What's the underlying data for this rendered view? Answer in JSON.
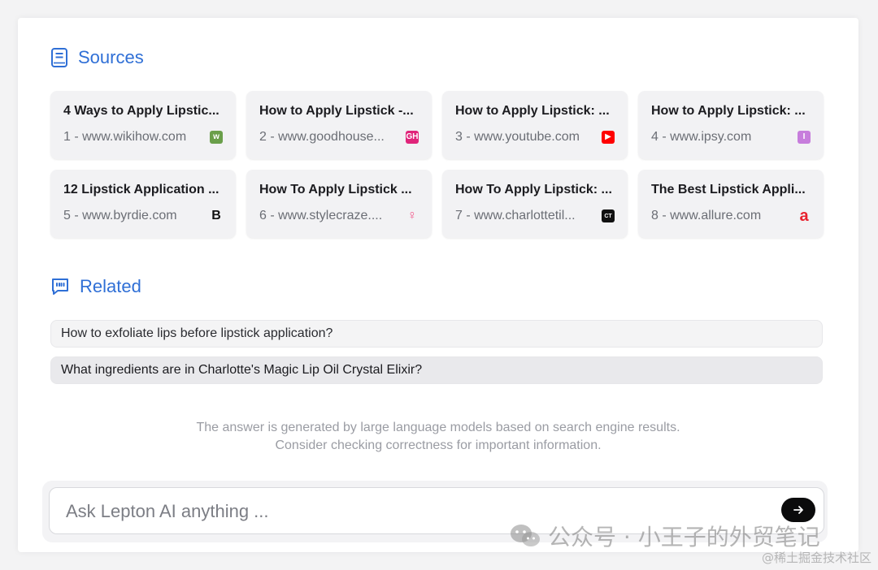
{
  "sources": {
    "heading": "Sources",
    "items": [
      {
        "title": "4 Ways to Apply Lipstic...",
        "meta": "1 - www.wikihow.com",
        "favicon": "wikihow-icon",
        "color": "#6a9f4a",
        "glyph": "w"
      },
      {
        "title": "How to Apply Lipstick -...",
        "meta": "2 - www.goodhouse...",
        "favicon": "goodhousekeeping-icon",
        "color": "#e0247a",
        "glyph": "GH"
      },
      {
        "title": "How to Apply Lipstick: ...",
        "meta": "3 - www.youtube.com",
        "favicon": "youtube-icon",
        "color": "#ff0000",
        "glyph": "▶"
      },
      {
        "title": "How to Apply Lipstick: ...",
        "meta": "4 - www.ipsy.com",
        "favicon": "ipsy-icon",
        "color": "#c77ddc",
        "glyph": "I"
      },
      {
        "title": "12 Lipstick Application ...",
        "meta": "5 - www.byrdie.com",
        "favicon": "byrdie-icon",
        "color": "#111111",
        "glyph": "B"
      },
      {
        "title": "How To Apply Lipstick ...",
        "meta": "6 - www.stylecraze....",
        "favicon": "stylecraze-icon",
        "color": "#f2588a",
        "glyph": "♀"
      },
      {
        "title": "How To Apply Lipstick: ...",
        "meta": "7 - www.charlottetil...",
        "favicon": "charlottetilbury-icon",
        "color": "#111111",
        "glyph": "CT"
      },
      {
        "title": "The Best Lipstick Appli...",
        "meta": "8 - www.allure.com",
        "favicon": "allure-icon",
        "color": "#e8232f",
        "glyph": "a"
      }
    ]
  },
  "related": {
    "heading": "Related",
    "items": [
      "How to exfoliate lips before lipstick application?",
      "What ingredients are in Charlotte's Magic Lip Oil Crystal Elixir?"
    ]
  },
  "disclaimer": {
    "line1": "The answer is generated by large language models based on search engine results.",
    "line2": "Consider checking correctness for important information."
  },
  "ask": {
    "placeholder": "Ask Lepton AI anything ..."
  },
  "watermark": {
    "text": "公众号 · 小王子的外贸笔记",
    "site": "@稀土掘金技术社区"
  },
  "colors": {
    "accent": "#2f6fd6",
    "card_bg": "#f2f2f4",
    "send_button": "#0b0b0c"
  }
}
